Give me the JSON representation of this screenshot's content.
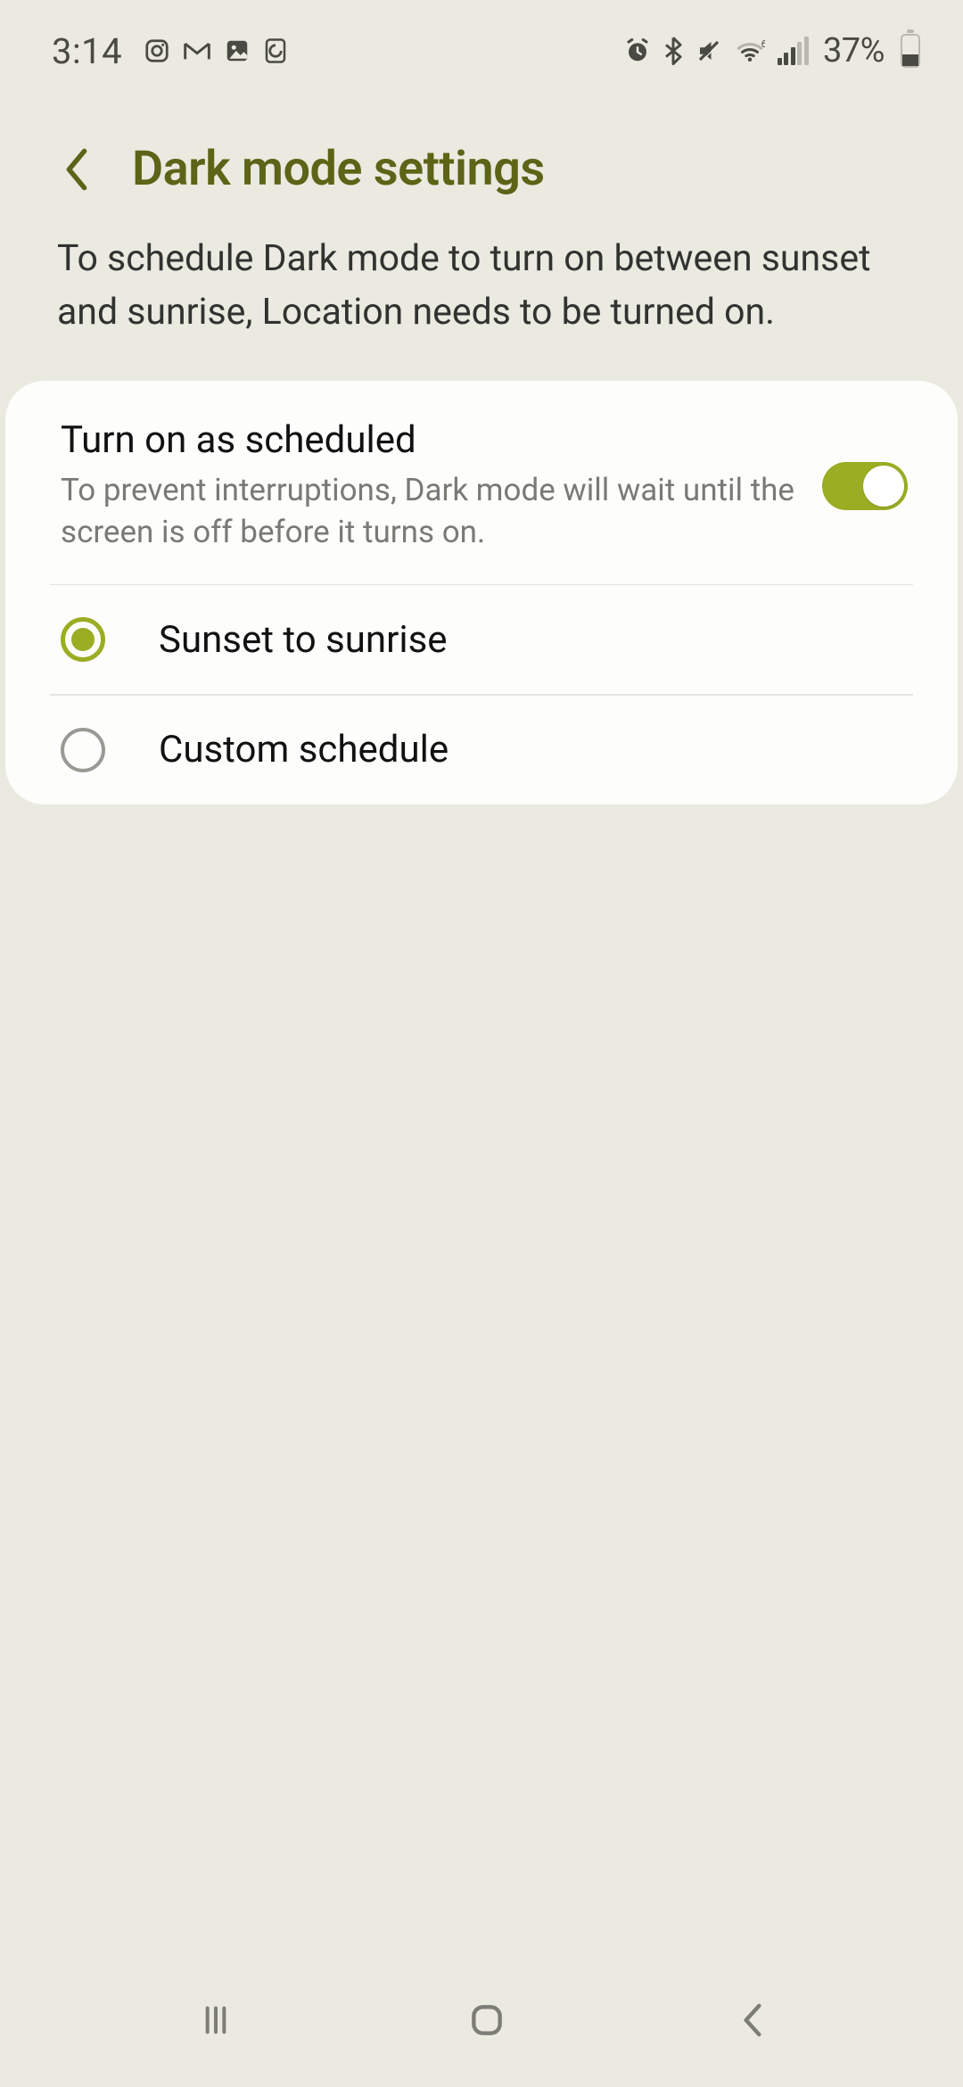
{
  "status": {
    "time": "3:14",
    "battery_pct": "37%"
  },
  "header": {
    "title": "Dark mode settings"
  },
  "intro": "To schedule Dark mode to turn on between sunset and sunrise, Location needs to be turned on.",
  "schedule": {
    "title": "Turn on as scheduled",
    "desc": "To prevent interruptions, Dark mode will wait until the screen is off before it turns on.",
    "enabled": true
  },
  "options": [
    {
      "label": "Sunset to sunrise",
      "selected": true
    },
    {
      "label": "Custom schedule",
      "selected": false
    }
  ]
}
